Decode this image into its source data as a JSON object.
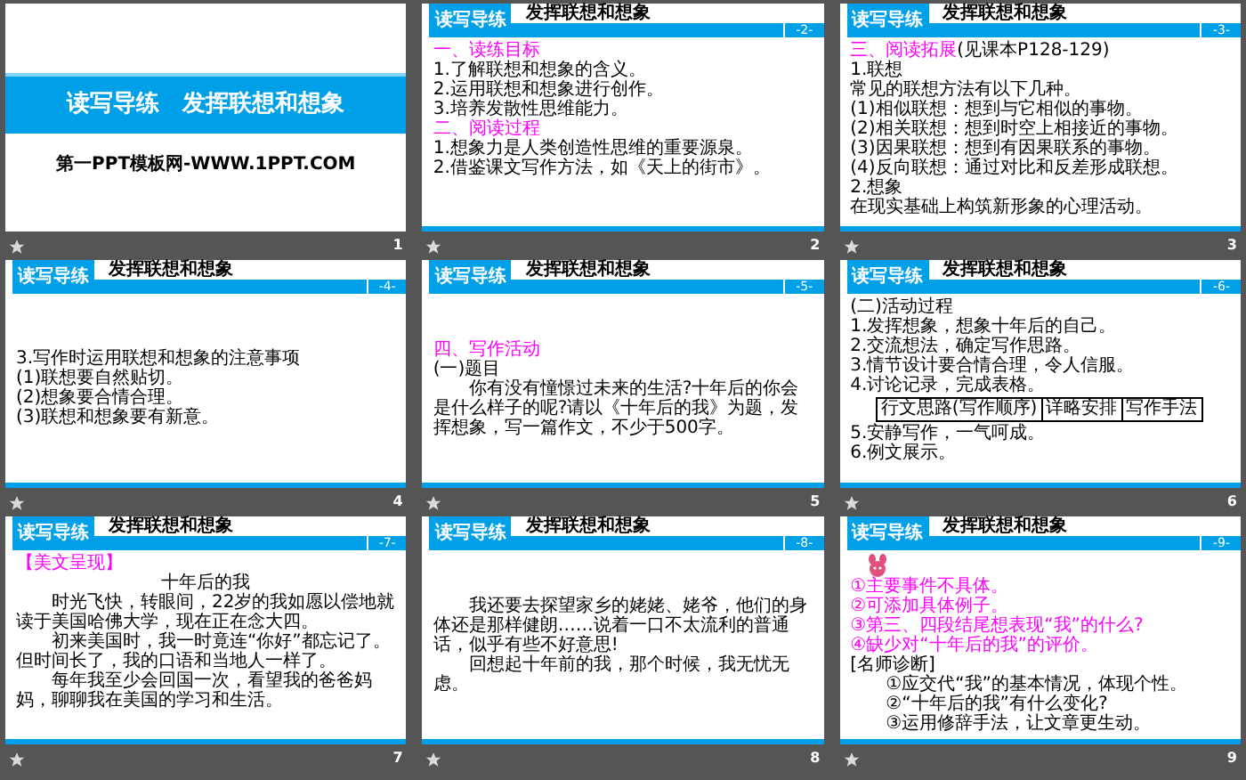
{
  "rows": [
    {
      "slides": [
        {
          "kind": "title",
          "number": "1",
          "title": "读写导练　发挥联想和想象",
          "subtitle": "第一PPT模板网-WWW.1PPT.COM"
        },
        {
          "kind": "content",
          "number": "2",
          "section": "读写导练",
          "title": "发挥联想和想象",
          "page": "-2-",
          "body": [
            {
              "kind": "heading",
              "text": "一、读练目标"
            },
            {
              "kind": "text",
              "text": "1.了解联想和想象的含义。"
            },
            {
              "kind": "text",
              "text": "2.运用联想和想象进行创作。"
            },
            {
              "kind": "text",
              "text": "3.培养发散性思维能力。"
            },
            {
              "kind": "heading",
              "text": "二、阅读过程"
            },
            {
              "kind": "text",
              "text": "1.想象力是人类创造性思维的重要源泉。"
            },
            {
              "kind": "text",
              "text": "2.借鉴课文写作方法，如《天上的街市》。"
            }
          ]
        },
        {
          "kind": "content",
          "number": "3",
          "section": "读写导练",
          "title": "发挥联想和想象",
          "page": "-3-",
          "body": [
            {
              "kind": "heading",
              "text": "三、阅读拓展",
              "note": "(见课本P128-129)"
            },
            {
              "kind": "text",
              "text": "1.联想"
            },
            {
              "kind": "text",
              "text": "常见的联想方法有以下几种。"
            },
            {
              "kind": "text",
              "text": "(1)相似联想：想到与它相似的事物。"
            },
            {
              "kind": "text",
              "text": "(2)相关联想：想到时空上相接近的事物。"
            },
            {
              "kind": "text",
              "text": "(3)因果联想：想到有因果联系的事物。"
            },
            {
              "kind": "text",
              "text": "(4)反向联想：通过对比和反差形成联想。"
            },
            {
              "kind": "text",
              "text": "2.想象"
            },
            {
              "kind": "text",
              "text": "在现实基础上构筑新形象的心理活动。"
            }
          ]
        }
      ]
    },
    {
      "slides": [
        {
          "kind": "centered",
          "number": "4",
          "section": "读写导练",
          "title": "发挥联想和想象",
          "page": "-4-",
          "body": [
            {
              "kind": "text",
              "text": "3.写作时运用联想和想象的注意事项"
            },
            {
              "kind": "text",
              "text": "(1)联想要自然贴切。"
            },
            {
              "kind": "text",
              "text": "(2)想象要合情合理。"
            },
            {
              "kind": "text",
              "text": "(3)联想和想象要有新意。"
            }
          ]
        },
        {
          "kind": "centered",
          "number": "5",
          "section": "读写导练",
          "title": "发挥联想和想象",
          "page": "-5-",
          "body": [
            {
              "kind": "heading",
              "text": "四、写作活动"
            },
            {
              "kind": "text",
              "text": "(一)题目"
            },
            {
              "kind": "indent",
              "text": "你有没有憧憬过未来的生活?十年后的你会是什么样子的呢?请以《十年后的我》为题，发挥想象，写一篇作文，不少于500字。"
            }
          ]
        },
        {
          "kind": "content",
          "number": "6",
          "section": "读写导练",
          "title": "发挥联想和想象",
          "page": "-6-",
          "body": [
            {
              "kind": "text",
              "text": "(二)活动过程"
            },
            {
              "kind": "text",
              "text": "1.发挥想象，想象十年后的自己。"
            },
            {
              "kind": "text",
              "text": "2.交流想法，确定写作思路。"
            },
            {
              "kind": "text",
              "text": "3.情节设计要合情合理，令人信服。"
            },
            {
              "kind": "text",
              "text": "4.讨论记录，完成表格。"
            },
            {
              "kind": "table",
              "cells": [
                "行文思路(写作顺序)",
                "详略安排",
                "写作手法"
              ]
            },
            {
              "kind": "text",
              "text": "5.安静写作，一气呵成。"
            },
            {
              "kind": "text",
              "text": "6.例文展示。"
            }
          ]
        }
      ]
    },
    {
      "slides": [
        {
          "kind": "content",
          "number": "7",
          "section": "读写导练",
          "title": "发挥联想和想象",
          "page": "-7-",
          "body": [
            {
              "kind": "heading",
              "text": "【美文呈现】"
            },
            {
              "kind": "title",
              "text": "十年后的我"
            },
            {
              "kind": "indent",
              "text": "时光飞快，转眼间，22岁的我如愿以偿地就读于美国哈佛大学，现在正在念大四。"
            },
            {
              "kind": "indent",
              "text": "初来美国时，我一时竟连“你好”都忘记了。但时间长了，我的口语和当地人一样了。"
            },
            {
              "kind": "indent",
              "text": "每年我至少会回国一次，看望我的爸爸妈妈，聊聊我在美国的学习和生活。"
            }
          ]
        },
        {
          "kind": "centered",
          "number": "8",
          "section": "读写导练",
          "title": "发挥联想和想象",
          "page": "-8-",
          "body": [
            {
              "kind": "indent",
              "text": "我还要去探望家乡的姥姥、姥爷，他们的身体还是那样健朗……说着一口不太流利的普通话，似乎有些不好意思!"
            },
            {
              "kind": "indent",
              "text": "回想起十年前的我，那个时候，我无忧无虑。"
            }
          ]
        },
        {
          "kind": "content",
          "number": "9",
          "section": "读写导练",
          "title": "发挥联想和想象",
          "page": "-9-",
          "body": [
            {
              "kind": "icon"
            },
            {
              "kind": "heading",
              "text": "①主要事件不具体。"
            },
            {
              "kind": "heading",
              "text": "②可添加具体例子。"
            },
            {
              "kind": "heading",
              "text": "③第三、四段结尾想表现“我”的什么?"
            },
            {
              "kind": "heading",
              "text": "④缺少对“十年后的我”的评价。"
            },
            {
              "kind": "text",
              "text": "[名师诊断]"
            },
            {
              "kind": "indent",
              "text": "①应交代“我”的基本情况，体现个性。"
            },
            {
              "kind": "indent",
              "text": "②“十年后的我”有什么变化?"
            },
            {
              "kind": "indent",
              "text": "③运用修辞手法，让文章更生动。"
            }
          ]
        }
      ]
    }
  ]
}
